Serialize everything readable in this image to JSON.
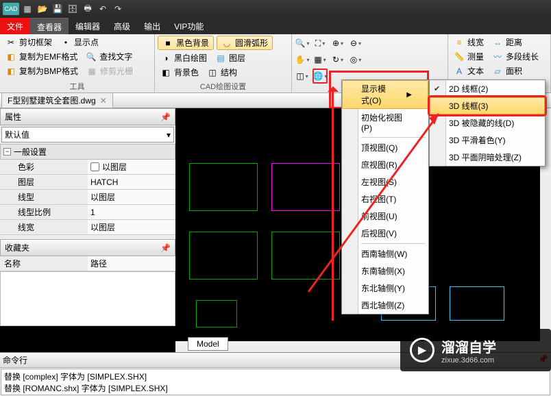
{
  "app": {
    "name": "CAD"
  },
  "qat_icons": [
    "new",
    "open",
    "save",
    "saveall",
    "print",
    "undo",
    "redo"
  ],
  "tabs": {
    "file": "文件",
    "view": "查看器",
    "editor": "编辑器",
    "advanced": "高级",
    "output": "输出",
    "vip": "VIP功能"
  },
  "ribbon": {
    "group_tools": {
      "title": "工具",
      "items": {
        "cut_frame": "剪切框架",
        "emf": "复制为EMF格式",
        "bmp": "复制为BMP格式",
        "show_point": "显示点",
        "find_text": "查找文字",
        "fix_raster": "修剪光栅"
      }
    },
    "group_cad": {
      "title": "CAD绘图设置",
      "items": {
        "black_bg": "黑色背景",
        "bw_draw": "黑白绘图",
        "bg_color": "背景色",
        "arc_smooth": "圆滑弧形",
        "layer": "图层",
        "structure": "结构"
      }
    },
    "group_right": {
      "linewidth": "线宽",
      "distance": "距离",
      "measure": "测量",
      "polylen": "多段线长",
      "text": "文本",
      "area": "面积"
    }
  },
  "doc_tab": "F型别墅建筑全套图.dwg",
  "props": {
    "title": "属性",
    "selector": "默认值",
    "cat": "一般设置",
    "rows": {
      "color": {
        "k": "色彩",
        "v": "以图层",
        "cb": true
      },
      "layer": {
        "k": "图层",
        "v": "HATCH"
      },
      "ltype": {
        "k": "线型",
        "v": "以图层"
      },
      "lscale": {
        "k": "线型比例",
        "v": "1"
      },
      "lwidth": {
        "k": "线宽",
        "v": "以图层"
      }
    },
    "fav_title": "收藏夹",
    "fav_cols": {
      "name": "名称",
      "path": "路径"
    }
  },
  "menu1": {
    "display_mode": "显示模式(O)",
    "reset_view": "初始化视图(P)",
    "top": "顶视图(Q)",
    "bottom": "庶视图(R)",
    "left": "左视图(S)",
    "right": "右视图(T)",
    "front": "前视图(U)",
    "back": "后视图(V)",
    "sw": "西南轴侧(W)",
    "se": "东南轴侧(X)",
    "ne": "东北轴侧(Y)",
    "nw": "西北轴侧(Z)"
  },
  "menu2": {
    "wf2d": "2D 线框(2)",
    "wf3d": "3D 线框(3)",
    "hidden3d": "3D 被隐藏的线(D)",
    "shade3d": "3D 平滑着色(Y)",
    "flat3d": "3D 平面阴暗处理(Z)"
  },
  "model_tab": "Model",
  "cmd": {
    "label": "命令行",
    "line1": "替换 [complex] 字体为 [SIMPLEX.SHX]",
    "line2": "替换 [ROMANC.shx] 字体为 [SIMPLEX.SHX]"
  },
  "watermark": {
    "brand": "溜溜自学",
    "url": "zixue.3d66.com"
  }
}
